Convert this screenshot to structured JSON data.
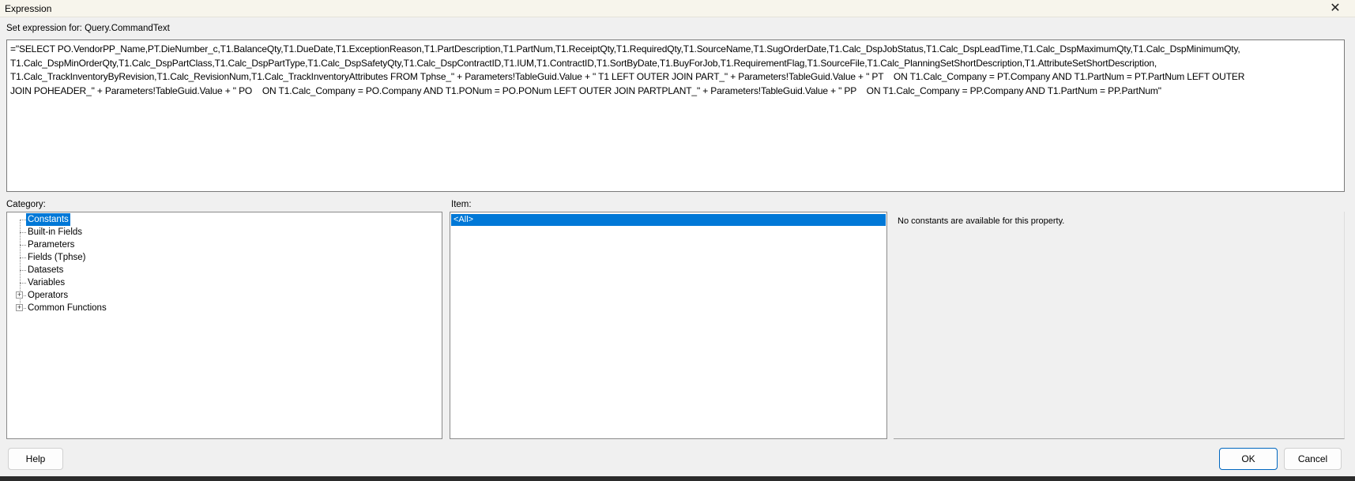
{
  "window": {
    "title": "Expression",
    "close_icon": "close-icon"
  },
  "expression": {
    "label": "Set expression for: Query.CommandText",
    "lines": [
      "=\"SELECT PO.VendorPP_Name,PT.DieNumber_c,T1.BalanceQty,T1.DueDate,T1.ExceptionReason,T1.PartDescription,T1.PartNum,T1.ReceiptQty,T1.RequiredQty,T1.SourceName,T1.SugOrderDate,T1.Calc_DspJobStatus,T1.Calc_DspLeadTime,T1.Calc_DspMaximumQty,T1.Calc_DspMinimumQty,",
      "T1.Calc_DspMinOrderQty,T1.Calc_DspPartClass,T1.Calc_DspPartType,T1.Calc_DspSafetyQty,T1.Calc_DspContractID,T1.IUM,T1.ContractID,T1.SortByDate,T1.BuyForJob,T1.RequirementFlag,T1.SourceFile,T1.Calc_PlanningSetShortDescription,T1.AttributeSetShortDescription,",
      "T1.Calc_TrackInventoryByRevision,T1.Calc_RevisionNum,T1.Calc_TrackInventoryAttributes FROM Tphse_\" + Parameters!TableGuid.Value + \" T1 LEFT OUTER JOIN PART_\" + Parameters!TableGuid.Value + \" PT    ON T1.Calc_Company = PT.Company AND T1.PartNum = PT.PartNum LEFT OUTER",
      "JOIN POHEADER_\" + Parameters!TableGuid.Value + \" PO    ON T1.Calc_Company = PO.Company AND T1.PONum = PO.PONum LEFT OUTER JOIN PARTPLANT_\" + Parameters!TableGuid.Value + \" PP    ON T1.Calc_Company = PP.Company AND T1.PartNum = PP.PartNum\""
    ]
  },
  "category": {
    "label": "Category:",
    "items": [
      {
        "label": "Constants",
        "selected": true,
        "expandable": false
      },
      {
        "label": "Built-in Fields",
        "expandable": false
      },
      {
        "label": "Parameters",
        "expandable": false
      },
      {
        "label": "Fields (Tphse)",
        "expandable": false
      },
      {
        "label": "Datasets",
        "expandable": false
      },
      {
        "label": "Variables",
        "expandable": false
      },
      {
        "label": "Operators",
        "expandable": true
      },
      {
        "label": "Common Functions",
        "expandable": true
      }
    ]
  },
  "item": {
    "label": "Item:",
    "items": [
      "<All>"
    ]
  },
  "description": "No constants are available for this property.",
  "buttons": {
    "help": "Help",
    "ok": "OK",
    "cancel": "Cancel"
  },
  "colors": {
    "selection": "#0078d7",
    "background": "#f0f0f0"
  }
}
